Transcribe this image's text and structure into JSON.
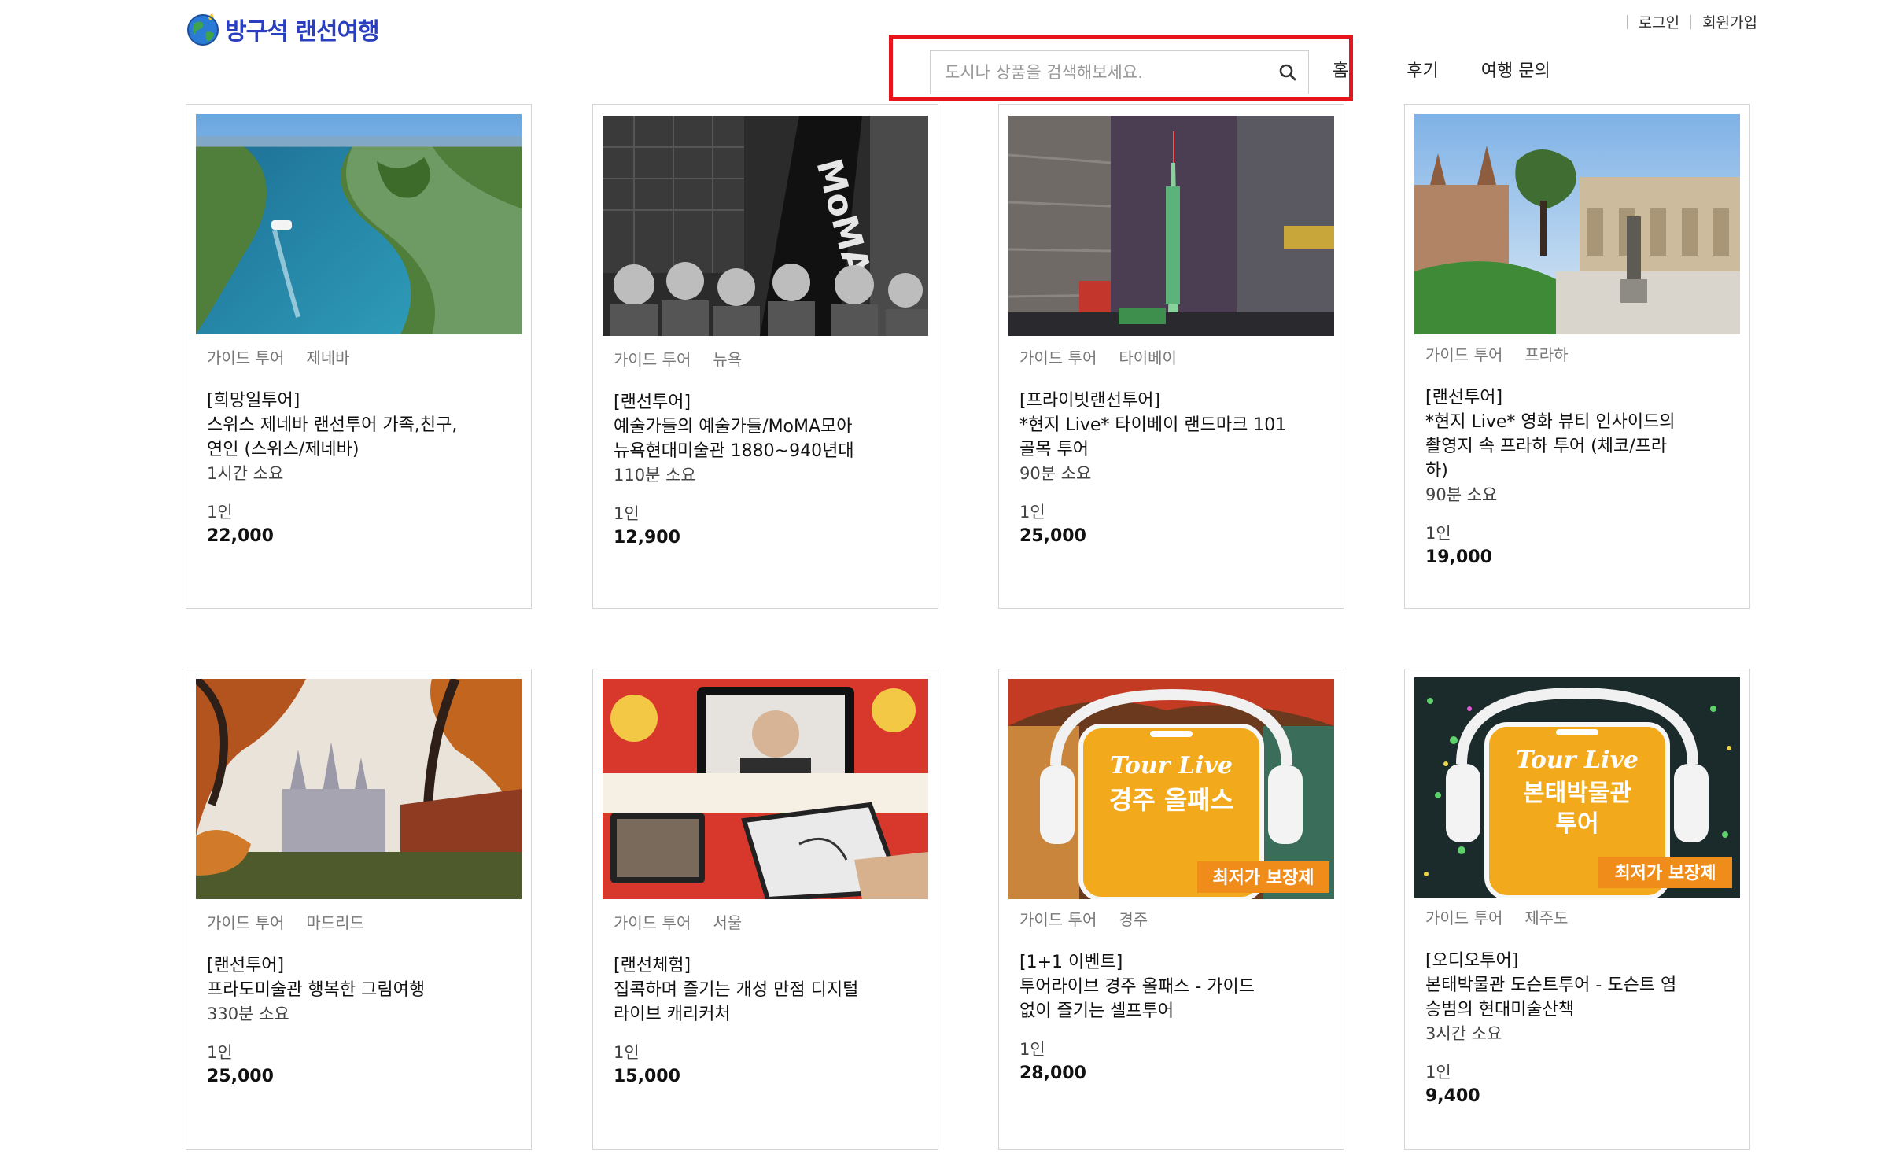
{
  "header": {
    "logo_text": "방구석 랜선여행",
    "login": "로그인",
    "signup": "회원가입"
  },
  "search": {
    "placeholder": "도시나 상품을 검색해보세요.",
    "icon": "search-icon"
  },
  "nav": {
    "items": [
      "홈",
      "후기",
      "여행 문의"
    ]
  },
  "colors": {
    "brand": "#2a3fbf",
    "highlight": "#e8141b",
    "card_border": "#d6d6d6"
  },
  "products": [
    {
      "category": "가이드 투어",
      "city": "제네바",
      "title_lines": [
        "[희망일투어]",
        "스위스 제네바 랜선투어 가족,친구,",
        "연인 (스위스/제네바)"
      ],
      "duration": "1시간 소요",
      "unit": "1인",
      "price": "22,000"
    },
    {
      "category": "가이드 투어",
      "city": "뉴욕",
      "title_lines": [
        "[랜선투어]",
        "예술가들의 예술가들/MoMA모아",
        "뉴욕현대미술관 1880~940년대"
      ],
      "duration": "110분 소요",
      "unit": "1인",
      "price": "12,900"
    },
    {
      "category": "가이드 투어",
      "city": "타이베이",
      "title_lines": [
        "[프라이빗랜선투어]",
        "*현지 Live* 타이베이 랜드마크 101",
        "골목 투어"
      ],
      "duration": "90분 소요",
      "unit": "1인",
      "price": "25,000"
    },
    {
      "category": "가이드 투어",
      "city": "프라하",
      "title_lines": [
        "[랜선투어]",
        "*현지 Live* 영화 뷰티 인사이드의",
        "촬영지 속 프라하 투어 (체코/프라",
        "하)"
      ],
      "duration": "90분 소요",
      "unit": "1인",
      "price": "19,000"
    },
    {
      "category": "가이드 투어",
      "city": "마드리드",
      "title_lines": [
        "[랜선투어]",
        "프라도미술관 행복한 그림여행"
      ],
      "duration": "330분 소요",
      "unit": "1인",
      "price": "25,000"
    },
    {
      "category": "가이드 투어",
      "city": "서울",
      "title_lines": [
        "[랜선체험]",
        "집콕하며 즐기는 개성 만점 디지털",
        "라이브 캐리커처"
      ],
      "duration": "",
      "unit": "1인",
      "price": "15,000"
    },
    {
      "category": "가이드 투어",
      "city": "경주",
      "title_lines": [
        "[1+1 이벤트]",
        "투어라이브 경주 올패스 - 가이드",
        "없이 즐기는 셀프투어"
      ],
      "duration": "",
      "unit": "1인",
      "price": "28,000",
      "banner": {
        "brand": "Tour Live",
        "lines": [
          "경주 올패스"
        ],
        "badge": "최저가 보장제"
      }
    },
    {
      "category": "가이드 투어",
      "city": "제주도",
      "title_lines": [
        "[오디오투어]",
        "본태박물관 도슨트투어 - 도슨트 염",
        "승범의 현대미술산책"
      ],
      "duration": "3시간 소요",
      "unit": "1인",
      "price": "9,400",
      "banner": {
        "brand": "Tour Live",
        "lines": [
          "본태박물관",
          "투어"
        ],
        "badge": "최저가 보장제"
      }
    }
  ]
}
